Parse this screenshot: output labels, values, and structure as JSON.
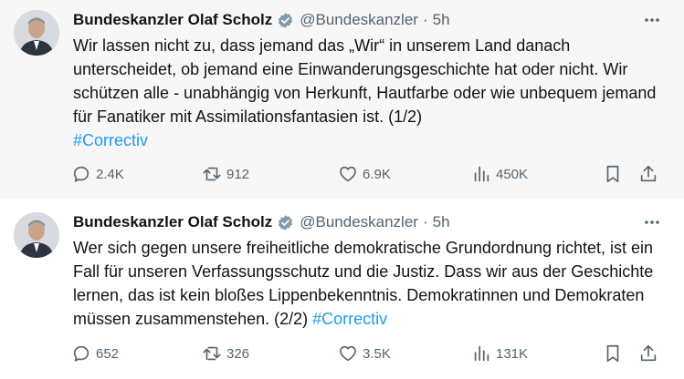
{
  "tweets": [
    {
      "name": "Bundeskanzler Olaf Scholz",
      "handle": "@Bundeskanzler",
      "separator": "·",
      "time": "5h",
      "text": "Wir lassen nicht zu, dass jemand das „Wir“ in unserem Land danach unterscheidet, ob jemand eine Einwanderungsgeschichte hat oder nicht. Wir schützen alle - unabhängig von Herkunft, Hautfarbe oder wie unbequem jemand für Fanatiker mit Assimilationsfantasien ist. (1/2)",
      "hashtag": "#Correctiv",
      "replies": "2.4K",
      "reposts": "912",
      "likes": "6.9K",
      "views": "450K"
    },
    {
      "name": "Bundeskanzler Olaf Scholz",
      "handle": "@Bundeskanzler",
      "separator": "·",
      "time": "5h",
      "text": "Wer sich gegen unsere freiheitliche demokratische Grundordnung richtet, ist ein Fall für unseren Verfassungsschutz und die Justiz. Dass wir aus der Geschichte lernen, das ist kein bloßes Lippenbekenntnis. Demokratinnen und Demokraten müssen zusammenstehen. (2/2)",
      "hashtag": "#Correctiv",
      "replies": "652",
      "reposts": "326",
      "likes": "3.5K",
      "views": "131K"
    }
  ],
  "icons": {
    "verified": "verified-badge-icon",
    "more": "more-icon",
    "reply": "reply-icon",
    "repost": "repost-icon",
    "like": "like-icon",
    "views": "views-icon",
    "bookmark": "bookmark-icon",
    "share": "share-icon"
  },
  "colors": {
    "accent": "#1d9bf0",
    "secondary_text": "#536471",
    "thread_line": "#cfd9de"
  }
}
